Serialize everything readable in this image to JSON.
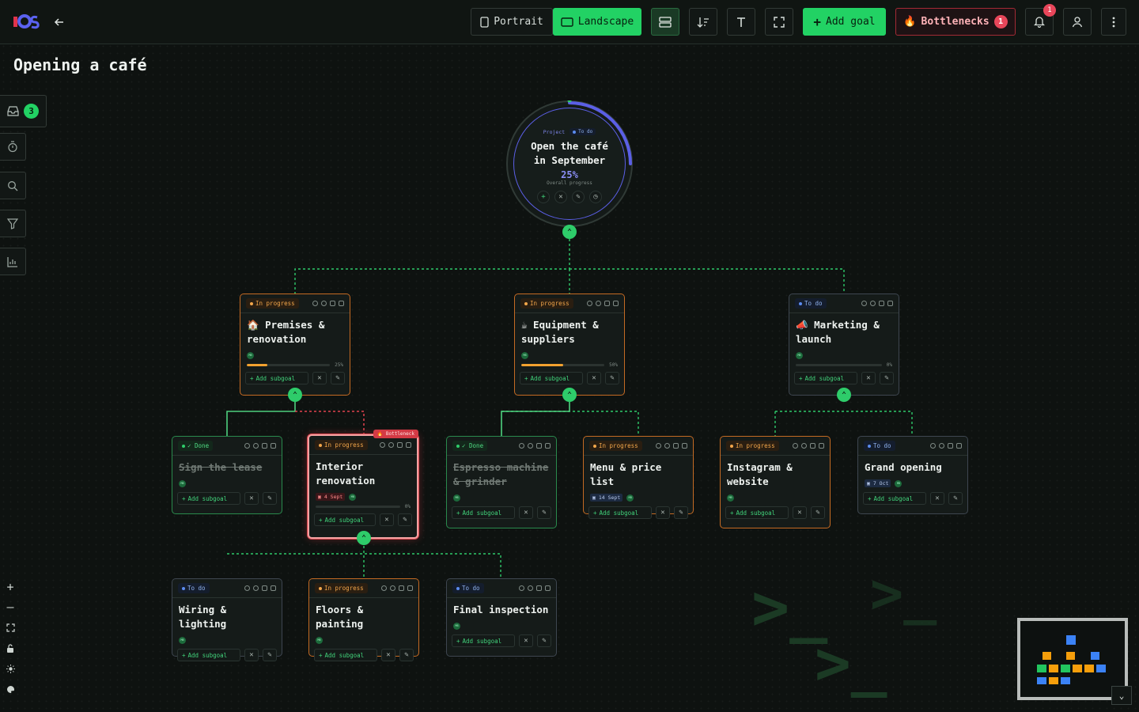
{
  "header": {
    "logo_text": "IOS",
    "back_icon": "arrow-left-icon",
    "portrait_label": "Portrait",
    "landscape_label": "Landscape",
    "add_goal_label": "Add goal",
    "bottlenecks_label": "Bottlenecks",
    "bottlenecks_count": "1",
    "notifications_count": "1"
  },
  "page": {
    "title": "Opening a café"
  },
  "sidebar": {
    "inbox_count": "3"
  },
  "root": {
    "type_label": "Project",
    "status_label": "To do",
    "title": "Open the café in September",
    "progress_text": "25%",
    "progress_value": 0.25,
    "progress_caption": "Overall progress"
  },
  "common": {
    "add_subgoal": "Add subgoal",
    "avatar_initials": "MB"
  },
  "nodes": {
    "premises": {
      "status": "In progress",
      "title": "🏠 Premises & renovation",
      "progress_text": "25%",
      "progress_value": 0.25
    },
    "equipment": {
      "status": "In progress",
      "title": "☕ Equipment & suppliers",
      "progress_text": "50%",
      "progress_value": 0.5
    },
    "marketing": {
      "status": "To do",
      "title": "📣 Marketing & launch",
      "progress_text": "0%",
      "progress_value": 0
    },
    "lease": {
      "status": "✓ Done",
      "title": "Sign the lease"
    },
    "interior": {
      "status": "In progress",
      "title": "Interior renovation",
      "badge": "🔥 Bottleneck",
      "date": "4 Sept",
      "progress_text": "0%",
      "progress_value": 0
    },
    "espresso": {
      "status": "✓ Done",
      "title": "Espresso machine & grinder"
    },
    "menu": {
      "status": "In progress",
      "title": "Menu & price list",
      "date": "14 Sept"
    },
    "instagram": {
      "status": "In progress",
      "title": "Instagram & website"
    },
    "grand": {
      "status": "To do",
      "title": "Grand opening",
      "date": "7 Oct"
    },
    "wiring": {
      "status": "To do",
      "title": "Wiring & lighting"
    },
    "floors": {
      "status": "In progress",
      "title": "Floors & painting"
    },
    "inspection": {
      "status": "To do",
      "title": "Final inspection"
    }
  },
  "colors": {
    "accent": "#22d264",
    "in_progress": "#f2a64a",
    "done": "#4fdc83",
    "todo": "#8fb2ee",
    "bottleneck": "#d33a45",
    "project_ring": "#5b5fe6"
  }
}
